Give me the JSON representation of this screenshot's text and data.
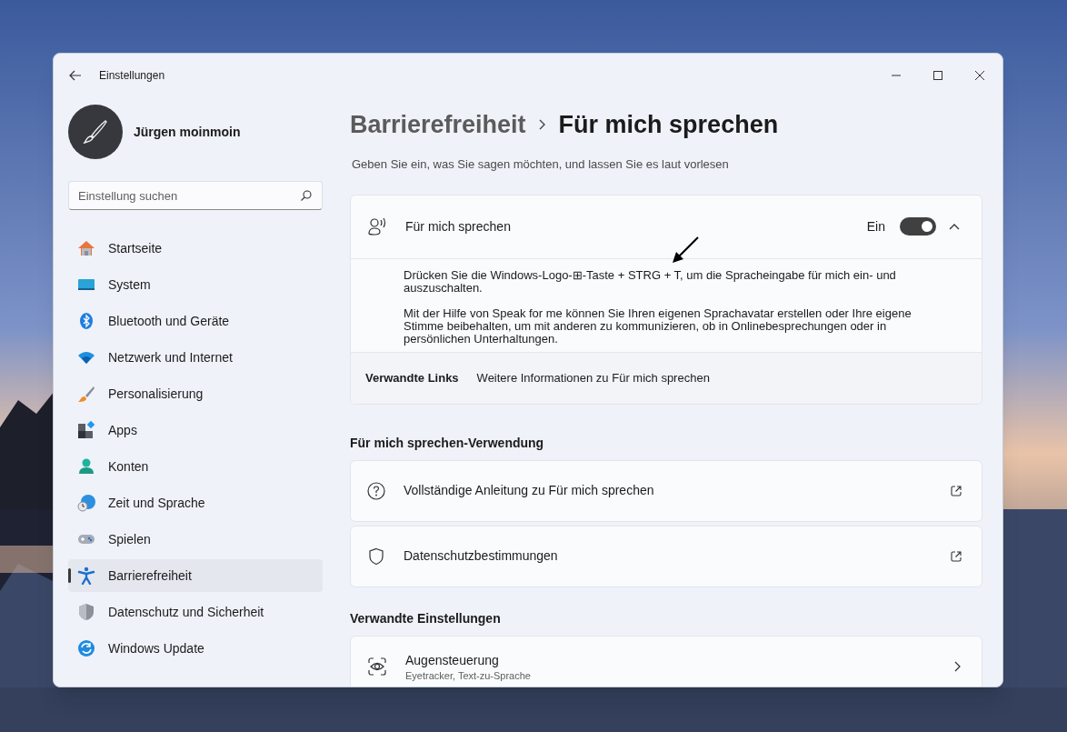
{
  "window": {
    "title": "Einstellungen"
  },
  "user": {
    "name": "Jürgen moinmoin"
  },
  "search": {
    "placeholder": "Einstellung suchen"
  },
  "nav": [
    {
      "label": "Startseite",
      "selected": false
    },
    {
      "label": "System",
      "selected": false
    },
    {
      "label": "Bluetooth und Geräte",
      "selected": false
    },
    {
      "label": "Netzwerk und Internet",
      "selected": false
    },
    {
      "label": "Personalisierung",
      "selected": false
    },
    {
      "label": "Apps",
      "selected": false
    },
    {
      "label": "Konten",
      "selected": false
    },
    {
      "label": "Zeit und Sprache",
      "selected": false
    },
    {
      "label": "Spielen",
      "selected": false
    },
    {
      "label": "Barrierefreiheit",
      "selected": true
    },
    {
      "label": "Datenschutz und Sicherheit",
      "selected": false
    },
    {
      "label": "Windows Update",
      "selected": false
    }
  ],
  "breadcrumb": [
    "Barrierefreiheit",
    "Für mich sprechen"
  ],
  "description": "Geben Sie ein, was Sie sagen möchten, und lassen Sie es laut vorlesen",
  "feature": {
    "title": "Für mich sprechen",
    "state_label": "Ein",
    "on": true,
    "expanded": true,
    "paragraphs": [
      "Drücken Sie die Windows-Logo-⊞-Taste + STRG + T, um die Spracheingabe für mich ein- und auszuschalten.",
      "Mit der Hilfe von Speak for me können Sie Ihren eigenen Sprachavatar erstellen oder Ihre eigene Stimme beibehalten, um mit anderen zu kommunizieren, ob in Onlinebesprechungen oder in persönlichen Unterhaltungen."
    ],
    "related_label": "Verwandte Links",
    "related_link": "Weitere Informationen zu Für mich sprechen"
  },
  "sections": [
    {
      "heading": "Für mich sprechen-Verwendung",
      "items": [
        {
          "title": "Vollständige Anleitung zu Für mich sprechen",
          "kind": "external"
        },
        {
          "title": "Datenschutzbestimmungen",
          "kind": "external"
        }
      ]
    },
    {
      "heading": "Verwandte Einstellungen",
      "items": [
        {
          "title": "Augensteuerung",
          "subtitle": "Eyetracker, Text-zu-Sprache",
          "kind": "page"
        }
      ]
    }
  ]
}
